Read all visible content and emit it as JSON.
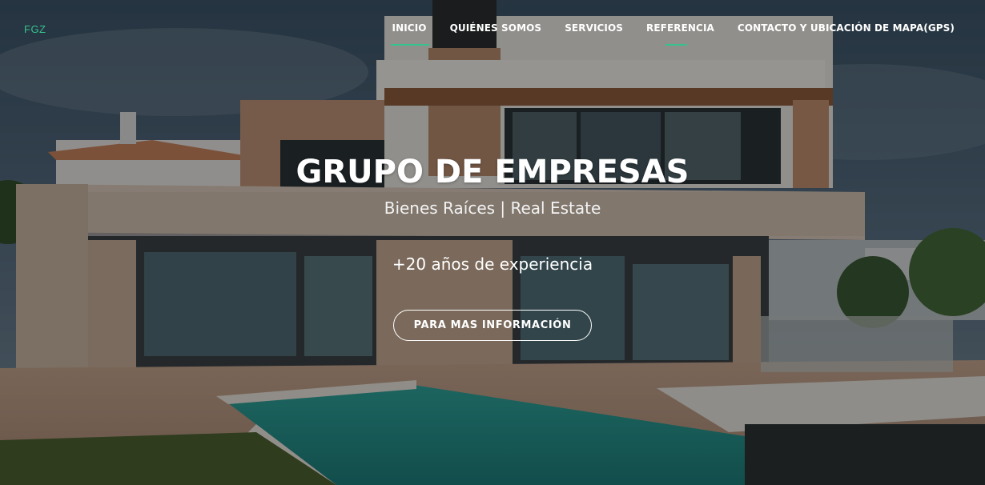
{
  "brand": {
    "logo_text": "FGZ"
  },
  "nav": {
    "items": [
      {
        "label": "INICIO"
      },
      {
        "label": "QUIÉNES SOMOS"
      },
      {
        "label": "SERVICIOS"
      },
      {
        "label": "REFERENCIA"
      },
      {
        "label": "CONTACTO Y UBICACIÓN DE MAPA(GPS)"
      }
    ]
  },
  "hero": {
    "title": "GRUPO DE EMPRESAS",
    "subtitle": "Bienes Raíces | Real Estate",
    "experience": "+20 años de experiencia",
    "cta_label": "PARA MAS INFORMACIÓN"
  },
  "colors": {
    "accent": "#34c28e",
    "text": "#ffffff"
  }
}
